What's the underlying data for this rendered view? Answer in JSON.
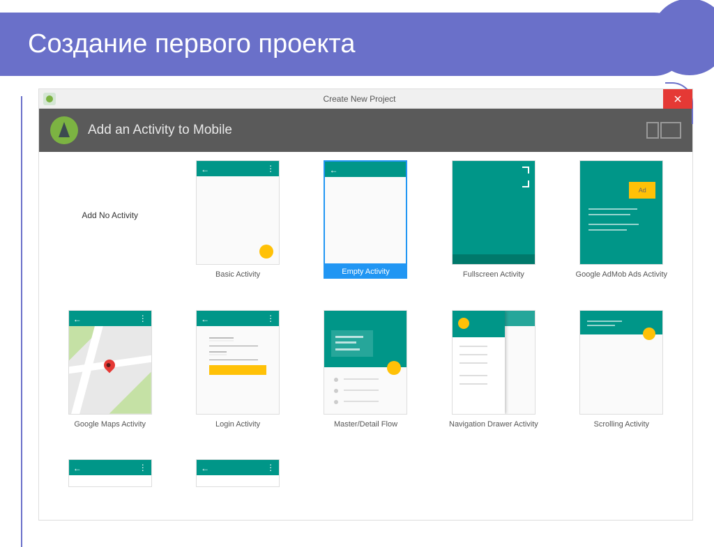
{
  "slide": {
    "title": "Создание первого проекта"
  },
  "window": {
    "title": "Create New Project",
    "header": "Add an Activity to Mobile"
  },
  "templates": {
    "row1": [
      {
        "label": "Add No Activity"
      },
      {
        "label": "Basic Activity"
      },
      {
        "label": "Empty Activity"
      },
      {
        "label": "Fullscreen Activity"
      },
      {
        "label": "Google AdMob Ads Activity"
      }
    ],
    "row2": [
      {
        "label": "Google Maps Activity"
      },
      {
        "label": "Login Activity"
      },
      {
        "label": "Master/Detail Flow"
      },
      {
        "label": "Navigation Drawer Activity"
      },
      {
        "label": "Scrolling Activity"
      }
    ]
  },
  "admob": {
    "ad_label": "Ad"
  }
}
